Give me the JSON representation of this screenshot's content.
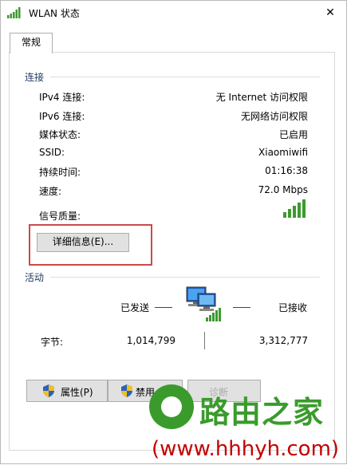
{
  "window": {
    "title": "WLAN 状态",
    "close_glyph": "✕",
    "icon": "wifi-signal-icon"
  },
  "tabs": [
    {
      "label": "常规"
    }
  ],
  "connection": {
    "section_title": "连接",
    "rows": [
      {
        "label": "IPv4 连接:",
        "value": "无 Internet 访问权限"
      },
      {
        "label": "IPv6 连接:",
        "value": "无网络访问权限"
      },
      {
        "label": "媒体状态:",
        "value": "已启用"
      },
      {
        "label": "SSID:",
        "value": "Xiaomiwifi"
      },
      {
        "label": "持续时间:",
        "value": "01:16:38"
      },
      {
        "label": "速度:",
        "value": "72.0 Mbps"
      },
      {
        "label": "信号质量:",
        "value": ""
      }
    ],
    "signal_bars_filled": 5,
    "signal_bars_total": 5,
    "details_button": "详细信息(E)..."
  },
  "activity": {
    "section_title": "活动",
    "sent_label": "已发送",
    "received_label": "已接收",
    "bytes_label": "字节:",
    "bytes_sent": "1,014,799",
    "bytes_received": "3,312,777"
  },
  "buttons": {
    "properties": "属性(P)",
    "disable": "禁用",
    "diagnose": "诊断"
  },
  "watermark": {
    "brand": "路由之家",
    "url": "(www.hhhyh.com)"
  },
  "colors": {
    "signal_green": "#3b9a2e",
    "highlight_red": "#c94a4a",
    "watermark_green": "#3a9b2c",
    "watermark_red": "#c40000"
  }
}
